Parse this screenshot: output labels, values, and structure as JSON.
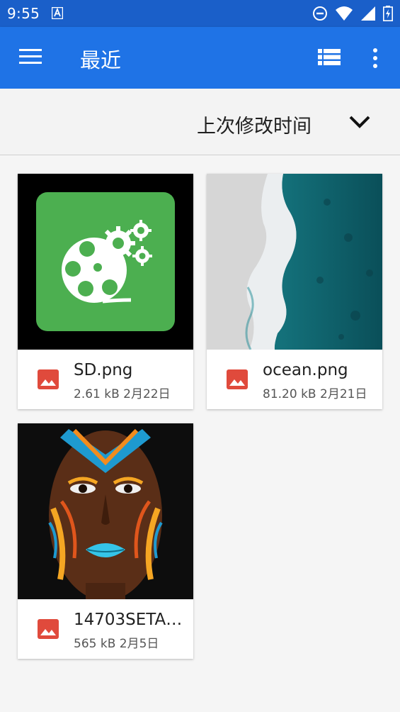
{
  "status_bar": {
    "time": "9:55",
    "icons": [
      "a-notification-icon",
      "do-not-disturb-icon",
      "wifi-icon",
      "cell-signal-icon",
      "battery-icon"
    ]
  },
  "app_bar": {
    "title": "最近",
    "icons": [
      "menu-icon",
      "list-view-icon",
      "more-vert-icon"
    ]
  },
  "sort": {
    "label": "上次修改时间"
  },
  "files": [
    {
      "name": "SD.png",
      "size": "2.61 kB",
      "date": "2月22日",
      "thumb": "sd-app-icon"
    },
    {
      "name": "ocean.png",
      "size": "81.20 kB",
      "date": "2月21日",
      "thumb": "ocean-aerial"
    },
    {
      "name": "14703SETA…",
      "size": "565 kB",
      "date": "2月5日",
      "thumb": "face-paint-portrait"
    }
  ],
  "colors": {
    "status_bar": "#1a5fc9",
    "app_bar": "#1f73e6",
    "image_icon": "#e04a3c",
    "background": "#f5f5f5"
  }
}
